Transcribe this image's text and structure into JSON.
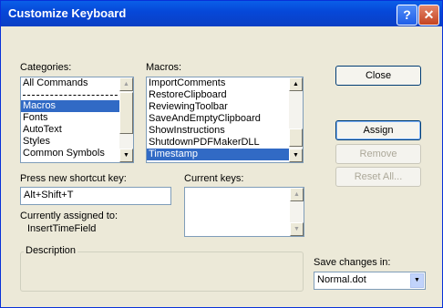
{
  "window": {
    "title": "Customize Keyboard"
  },
  "icons": {
    "help": "help-icon",
    "close": "close-icon"
  },
  "categories": {
    "label": "Categories:",
    "items": [
      "All Commands",
      "Macros",
      "Fonts",
      "AutoText",
      "Styles",
      "Common Symbols"
    ],
    "selected": "Macros"
  },
  "macros": {
    "label": "Macros:",
    "items": [
      "ImportComments",
      "RestoreClipboard",
      "ReviewingToolbar",
      "SaveAndEmptyClipboard",
      "ShowInstructions",
      "ShutdownPDFMakerDLL",
      "Timestamp"
    ],
    "selected": "Timestamp"
  },
  "shortcut": {
    "label": "Press new shortcut key:",
    "value": "Alt+Shift+T"
  },
  "current_keys": {
    "label": "Current keys:"
  },
  "assigned": {
    "label": "Currently assigned to:",
    "value": "InsertTimeField"
  },
  "description": {
    "label": "Description"
  },
  "save_changes": {
    "label": "Save changes in:",
    "value": "Normal.dot"
  },
  "buttons": {
    "close": "Close",
    "assign": "Assign",
    "remove": "Remove",
    "reset_all": "Reset All..."
  },
  "colors": {
    "title_bar": "#0a5fe8",
    "selection": "#316ac5",
    "dialog_bg": "#ece9d8"
  }
}
